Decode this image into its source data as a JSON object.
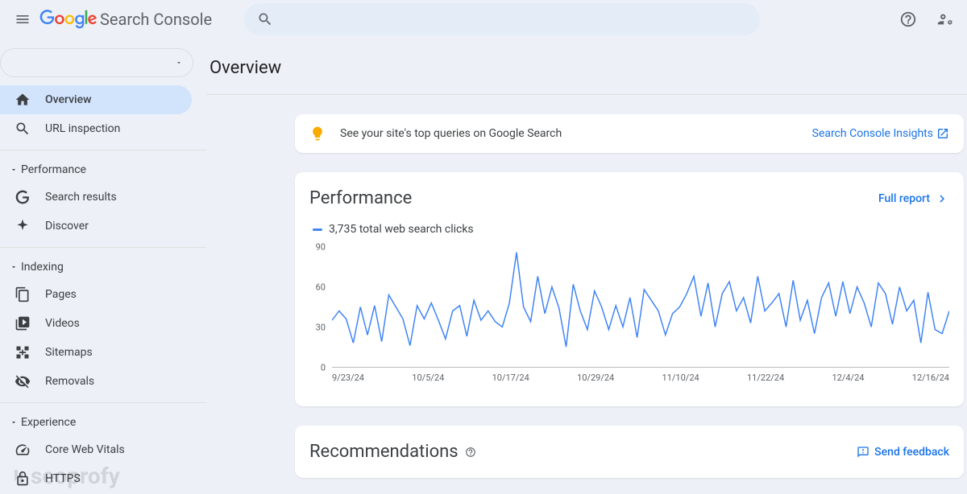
{
  "header": {
    "product_name": "Search Console"
  },
  "property_selector": {},
  "sidebar": {
    "top": [
      {
        "label": "Overview",
        "active": true
      },
      {
        "label": "URL inspection",
        "active": false
      }
    ],
    "sections": [
      {
        "title": "Performance",
        "items": [
          {
            "label": "Search results"
          },
          {
            "label": "Discover"
          }
        ]
      },
      {
        "title": "Indexing",
        "items": [
          {
            "label": "Pages"
          },
          {
            "label": "Videos"
          },
          {
            "label": "Sitemaps"
          },
          {
            "label": "Removals"
          }
        ]
      },
      {
        "title": "Experience",
        "items": [
          {
            "label": "Core Web Vitals"
          },
          {
            "label": "HTTPS"
          }
        ]
      }
    ]
  },
  "page": {
    "title": "Overview"
  },
  "insights": {
    "text": "See your site's top queries on Google Search",
    "link": "Search Console Insights"
  },
  "performance": {
    "title": "Performance",
    "full_report": "Full report",
    "legend": "3,735 total web search clicks"
  },
  "recommendations": {
    "title": "Recommendations",
    "feedback": "Send feedback"
  },
  "chart_data": {
    "type": "line",
    "ylabel": "",
    "xlabel": "",
    "ylim": [
      0,
      90
    ],
    "yticks": [
      0,
      30,
      60,
      90
    ],
    "categories": [
      "9/23/24",
      "10/5/24",
      "10/17/24",
      "10/29/24",
      "11/10/24",
      "11/22/24",
      "12/4/24",
      "12/16/24"
    ],
    "series": [
      {
        "name": "web search clicks",
        "color": "#4285f4",
        "values": [
          35,
          42,
          36,
          18,
          45,
          24,
          46,
          19,
          54,
          45,
          36,
          16,
          46,
          36,
          48,
          35,
          21,
          42,
          46,
          23,
          50,
          35,
          42,
          34,
          30,
          48,
          86,
          45,
          34,
          68,
          40,
          60,
          44,
          15,
          62,
          42,
          28,
          57,
          45,
          28,
          46,
          30,
          52,
          22,
          58,
          50,
          42,
          24,
          40,
          45,
          55,
          68,
          38,
          63,
          30,
          55,
          64,
          42,
          52,
          33,
          68,
          42,
          48,
          55,
          30,
          65,
          35,
          50,
          25,
          52,
          63,
          38,
          64,
          40,
          60,
          48,
          30,
          63,
          55,
          32,
          60,
          42,
          50,
          18,
          56,
          28,
          25,
          42
        ]
      }
    ]
  },
  "watermark": "seoprofy"
}
